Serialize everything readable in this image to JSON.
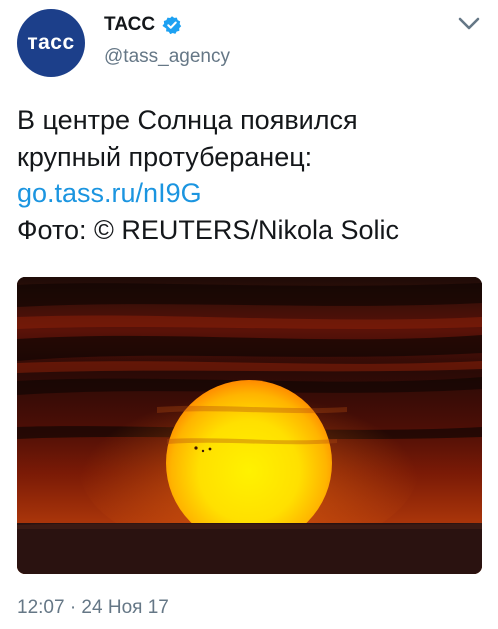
{
  "author": {
    "avatar_text": "тасс",
    "display_name": "ТАСС",
    "handle": "@tass_agency",
    "verified": true
  },
  "tweet": {
    "line1": "В центре Солнца появился",
    "line2": "крупный протуберанец:",
    "link": "go.tass.ru/nI9G",
    "credit": "Фото: © REUTERS/Nikola Solic"
  },
  "meta": {
    "timestamp": "12:07 · 24 Ноя 17"
  },
  "icons": {
    "verified": "verified-badge-icon",
    "menu": "chevron-down-icon"
  },
  "colors": {
    "brand_blue": "#1c3f8a",
    "link": "#1b95e0",
    "verified": "#1da1f2",
    "muted": "#657786"
  }
}
